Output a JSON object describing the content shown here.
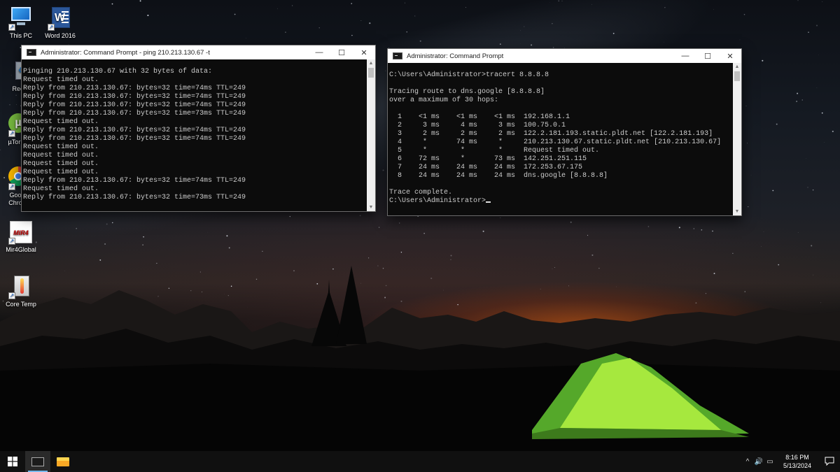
{
  "desktop": {
    "icons": [
      {
        "label": "This PC",
        "icon": "this-pc-icon"
      },
      {
        "label": "Word 2016",
        "icon": "word-icon"
      },
      {
        "label": "Recyc",
        "icon": "recycle-bin-icon"
      },
      {
        "label": "µTorr",
        "icon": "utorrent-icon"
      },
      {
        "label": "Goo\nChro",
        "icon": "chrome-icon"
      },
      {
        "label": "Mir4Global",
        "icon": "mir4-icon"
      },
      {
        "label": "Core Temp",
        "icon": "core-temp-icon"
      }
    ],
    "mir4_logo_text": "MIR4"
  },
  "ping_window": {
    "title": "Administrator: Command Prompt - ping  210.213.130.67 -t",
    "output": "\nPinging 210.213.130.67 with 32 bytes of data:\nRequest timed out.\nReply from 210.213.130.67: bytes=32 time=74ms TTL=249\nReply from 210.213.130.67: bytes=32 time=74ms TTL=249\nReply from 210.213.130.67: bytes=32 time=74ms TTL=249\nReply from 210.213.130.67: bytes=32 time=73ms TTL=249\nRequest timed out.\nReply from 210.213.130.67: bytes=32 time=74ms TTL=249\nReply from 210.213.130.67: bytes=32 time=74ms TTL=249\nRequest timed out.\nRequest timed out.\nRequest timed out.\nRequest timed out.\nReply from 210.213.130.67: bytes=32 time=74ms TTL=249\nRequest timed out.\nReply from 210.213.130.67: bytes=32 time=73ms TTL=249"
  },
  "tracert_window": {
    "title": "Administrator: Command Prompt",
    "output": "\nC:\\Users\\Administrator>tracert 8.8.8.8\n\nTracing route to dns.google [8.8.8.8]\nover a maximum of 30 hops:\n\n  1    <1 ms    <1 ms    <1 ms  192.168.1.1\n  2     3 ms     4 ms     3 ms  100.75.0.1\n  3     2 ms     2 ms     2 ms  122.2.181.193.static.pldt.net [122.2.181.193]\n  4     *       74 ms     *     210.213.130.67.static.pldt.net [210.213.130.67]\n  5     *        *        *     Request timed out.\n  6    72 ms     *       73 ms  142.251.251.115\n  7    24 ms    24 ms    24 ms  172.253.67.175\n  8    24 ms    24 ms    24 ms  dns.google [8.8.8.8]\n\nTrace complete.\n",
    "prompt": "C:\\Users\\Administrator>"
  },
  "window_controls": {
    "minimize": "—",
    "maximize": "☐",
    "close": "✕"
  },
  "taskbar": {
    "time": "8:16 PM",
    "date": "5/13/2024",
    "tray_chevron": "^",
    "volume": "🔊",
    "network": "▭"
  },
  "colors": {
    "console_bg": "#0c0c0c",
    "console_text": "#cccccc",
    "taskbar": "#101010"
  }
}
